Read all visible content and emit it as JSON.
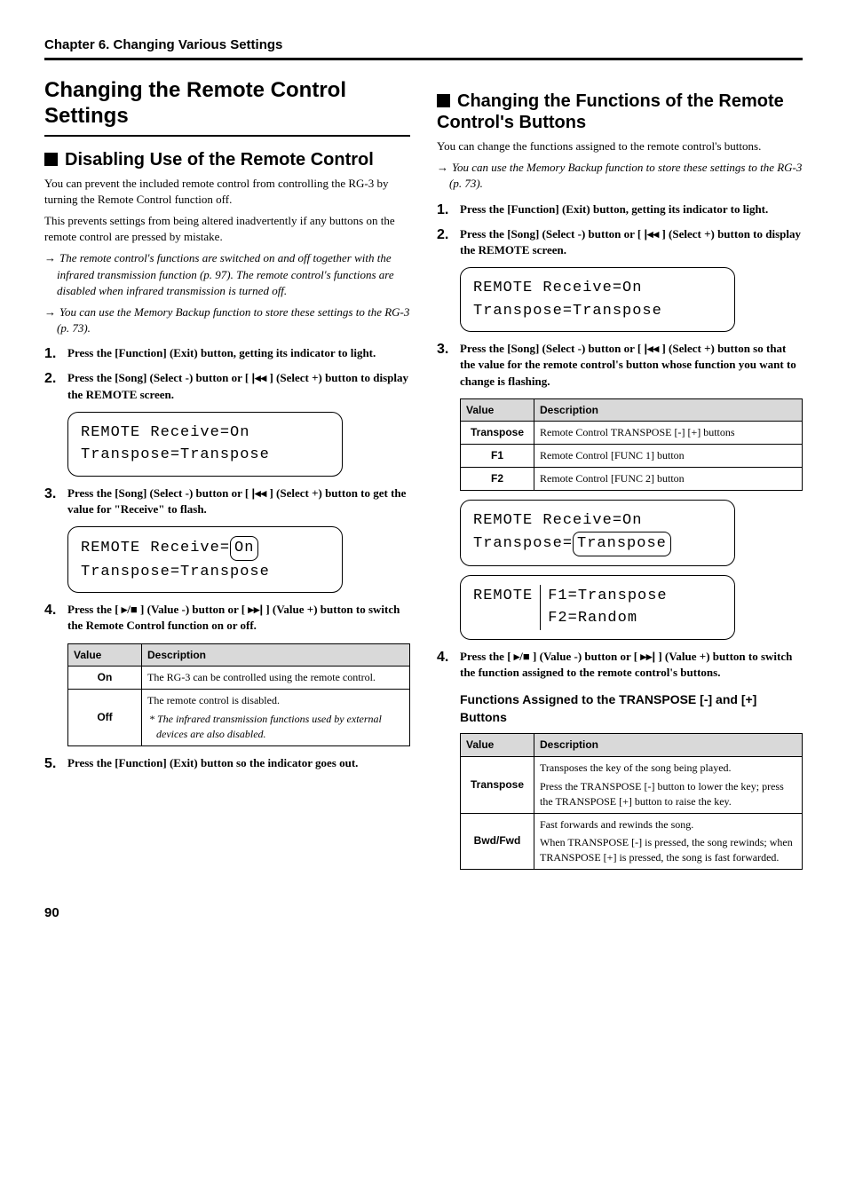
{
  "header": "Chapter 6. Changing Various Settings",
  "left": {
    "title": "Changing the Remote Control Settings",
    "section_title": "Disabling Use of the Remote Control",
    "intro1": "You can prevent the included remote control from controlling the RG-3 by turning the Remote Control function off.",
    "intro2": "This prevents settings from being altered inadvertently if any buttons on the remote control are pressed by mistake.",
    "note1": "The remote control's functions are switched on and off together with the infrared transmission function (p. 97). The remote control's functions are disabled when infrared transmission is turned off.",
    "note2": "You can use the Memory Backup function to store these settings to the RG-3 (p. 73).",
    "step1": "Press the [Function] (Exit) button, getting its indicator to light.",
    "step2a": "Press the [Song] (Select -) button or [ ",
    "step2b": " ] (Select +) button to display the REMOTE screen.",
    "lcd1_line1": "REMOTE   Receive=On",
    "lcd1_line2": " Transpose=Transpose",
    "step3a": "Press the [Song] (Select -) button or [ ",
    "step3b": " ] (Select +) button to get the value for \"Receive\" to flash.",
    "lcd2_line1a": "REMOTE   Receive=",
    "lcd2_line1b": "On",
    "lcd2_line2": " Transpose=Transpose",
    "step4a": "Press the [ ",
    "step4b": " ] (Value -) button or [ ",
    "step4c": " ] (Value +) button to switch the Remote Control function on or off.",
    "table": {
      "h1": "Value",
      "h2": "Description",
      "r1v": "On",
      "r1d": "The RG-3 can be controlled using the remote control.",
      "r2v": "Off",
      "r2d1": "The remote control is disabled.",
      "r2d2": "The infrared transmission functions used by external devices are also disabled."
    },
    "step5": "Press the [Function] (Exit) button so the indicator goes out."
  },
  "right": {
    "section_title": "Changing the Functions of the Remote Control's Buttons",
    "intro": "You can change the functions assigned to the remote control's buttons.",
    "note1": "You can use the Memory Backup function to store these settings to the RG-3 (p. 73).",
    "step1": "Press the [Function] (Exit) button, getting its indicator to light.",
    "step2a": "Press the [Song] (Select -) button or [ ",
    "step2b": " ] (Select +) button to display the REMOTE screen.",
    "lcd1_line1": "REMOTE   Receive=On",
    "lcd1_line2": " Transpose=Transpose",
    "step3a": "Press the [Song] (Select -) button or [ ",
    "step3b": " ] (Select +) button so that the value for the remote control's button whose function you want to change is flashing.",
    "table1": {
      "h1": "Value",
      "h2": "Description",
      "r1v": "Transpose",
      "r1d": "Remote Control TRANSPOSE [-] [+] buttons",
      "r2v": "F1",
      "r2d": "Remote Control [FUNC 1] button",
      "r3v": "F2",
      "r3d": "Remote Control [FUNC 2] button"
    },
    "lcd2_line1": "REMOTE   Receive=On",
    "lcd2_line2a": " Transpose=",
    "lcd2_line2b": "Transpose",
    "lcd3_line1a": "REMOTE",
    "lcd3_line1b": "F1=Transpose",
    "lcd3_line2": "F2=Random",
    "step4a": "Press the [ ",
    "step4b": " ] (Value -) button or [ ",
    "step4c": " ] (Value +) button to switch the function assigned to the remote control's buttons.",
    "functions_title": "Functions Assigned to the TRANSPOSE [-] and [+] Buttons",
    "table2": {
      "h1": "Value",
      "h2": "Description",
      "r1v": "Transpose",
      "r1d1": "Transposes the key of the song being played.",
      "r1d2": "Press the TRANSPOSE [-] button to lower the key; press the TRANSPOSE [+] button to raise the key.",
      "r2v": "Bwd/Fwd",
      "r2d1": "Fast forwards and rewinds the song.",
      "r2d2": "When TRANSPOSE [-] is pressed, the song rewinds; when TRANSPOSE [+] is pressed, the song is fast forwarded."
    }
  },
  "icons": {
    "prev": "◂◂",
    "playstop": "▸/■",
    "next": "▸▸"
  },
  "page_num": "90"
}
